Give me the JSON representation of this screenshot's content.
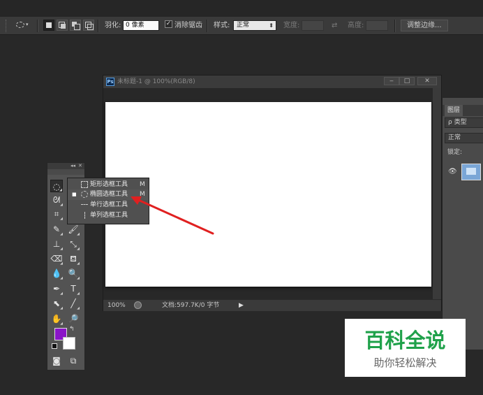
{
  "options_bar": {
    "feather_label": "羽化:",
    "feather_value": "0 像素",
    "antialias_label": "消除锯齿",
    "antialias_checked": true,
    "style_label": "样式:",
    "style_value": "正常",
    "width_label": "宽度:",
    "height_label": "高度:",
    "refine_edge_label": "调整边缘..."
  },
  "document": {
    "title": "未标题-1 @ 100%(RGB/8)",
    "app_icon_text": "Ps",
    "zoom": "100%",
    "info": "文档:597.7K/0 字节"
  },
  "flyout": {
    "items": [
      {
        "label": "矩形选框工具",
        "shortcut": "M",
        "selected": false
      },
      {
        "label": "椭圆选框工具",
        "shortcut": "M",
        "selected": true
      },
      {
        "label": "单行选框工具",
        "shortcut": "",
        "selected": false
      },
      {
        "label": "单列选框工具",
        "shortcut": "",
        "selected": false
      }
    ]
  },
  "layers": {
    "tab_label": "图层",
    "kind_filter": "ρ 类型",
    "blend_mode": "正常",
    "lock_label": "锁定:"
  },
  "colors": {
    "foreground": "#8a14c8",
    "background": "#ffffff",
    "annotation_arrow": "#e02020"
  },
  "watermark": {
    "main_text": "百科全说",
    "sub_text": "助你轻松解决"
  }
}
